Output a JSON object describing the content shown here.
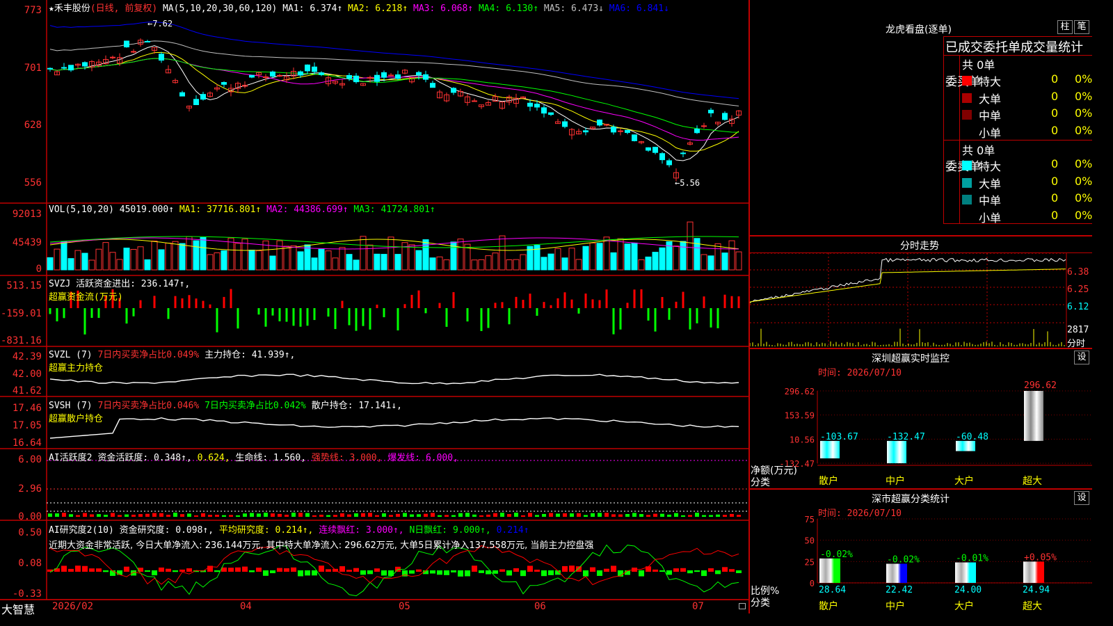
{
  "header": {
    "star": "★",
    "stock_name": "禾丰股份",
    "mode": "(日线, 前复权)",
    "ma_label": "MA(5,10,20,30,60,120)",
    "ma1": "MA1: 6.374↑",
    "ma2": "MA2: 6.218↑",
    "ma3": "MA3: 6.068↑",
    "ma4": "MA4: 6.130↑",
    "ma5": "MA5: 6.473↓",
    "ma6": "MA6: 6.841↓"
  },
  "price_axis": [
    "773",
    "701",
    "628",
    "556"
  ],
  "price_marks": {
    "high": "7.62",
    "low": "5.56"
  },
  "vol_header": {
    "label": "VOL(5,10,20)",
    "value": "45019.000↑",
    "ma1": "MA1: 37716.801↑",
    "ma2": "MA2: 44386.699↑",
    "ma3": "MA3: 41724.801↑"
  },
  "vol_axis": [
    "92013",
    "45439",
    "0"
  ],
  "svzj_header": {
    "l1": "SVZJ  活跃资金进出: 236.147↑,",
    "l2": "超赢资金流(万元)"
  },
  "svzj_axis": [
    "513.15",
    "-159.01",
    "-831.16"
  ],
  "svzl_header": {
    "l1a": "SVZL (7)",
    "l1b": "7日内买卖净占比0.049%",
    "l1c": "主力持仓: 41.939↑,",
    "l2": "超赢主力持仓"
  },
  "svzl_axis": [
    "42.39",
    "42.00",
    "41.62"
  ],
  "svsh_header": {
    "l1a": "SVSH (7)",
    "l1b": "7日内买卖净占比0.046%",
    "l1c": "7日内买卖净占比0.042%",
    "l1d": "散户持仓: 17.141↓,",
    "l2": "超赢散户持仓"
  },
  "svsh_axis": [
    "17.46",
    "17.05",
    "16.64"
  ],
  "ai1_header": {
    "a": "AI活跃度2",
    "b": "资金活跃度: 0.348↑,",
    "c": "0.624,",
    "d": "生命线: 1.560,",
    "e": "强势线: 3.000,",
    "f": "爆发线: 6.000,"
  },
  "ai1_axis": [
    "6.00",
    "2.96",
    "0.00"
  ],
  "ai2_header": {
    "a": "AI研究度2(10)",
    "b": "资金研究度: 0.098↑,",
    "c": "平均研究度: 0.214↑,",
    "d": "连续飘红: 3.000↑,",
    "e": "N日飘红: 9.000↑,",
    "f": "0.214↑",
    "note": "近期大资金非常活跃, 今日大单净流入: 236.144万元, 其中特大单净流入: 296.62万元, 大单5日累计净入137.558万元, 当前主力控盘强"
  },
  "ai2_axis": [
    "0.50",
    "0.08",
    "-0.33"
  ],
  "x_axis": [
    "2026/02",
    "04",
    "05",
    "06",
    "07"
  ],
  "brand": "大智慧",
  "longhu": {
    "title": "龙虎看盘(逐单)",
    "btn_bar": "柱",
    "btn_pen": "笔",
    "tabs": "已成交委托单成交量统计",
    "buy_side": "委买单",
    "sell_side": "委卖单",
    "buy_total": "共 0单",
    "sell_total": "共 0单",
    "buy_rows": [
      {
        "name": "特大",
        "count": "0",
        "pct": "0%",
        "color": "#ff0000"
      },
      {
        "name": "大单",
        "count": "0",
        "pct": "0%",
        "color": "#aa0000"
      },
      {
        "name": "中单",
        "count": "0",
        "pct": "0%",
        "color": "#800000"
      },
      {
        "name": "小单",
        "count": "0",
        "pct": "0%",
        "color": ""
      }
    ],
    "sell_rows": [
      {
        "name": "特大",
        "count": "0",
        "pct": "0%",
        "color": "#00ffff"
      },
      {
        "name": "大单",
        "count": "0",
        "pct": "0%",
        "color": "#00a0a0"
      },
      {
        "name": "中单",
        "count": "0",
        "pct": "0%",
        "color": "#008080"
      },
      {
        "name": "小单",
        "count": "0",
        "pct": "0%",
        "color": ""
      }
    ]
  },
  "intraday": {
    "title": "分时走势",
    "price_axis": [
      "6.38",
      "6.25",
      "6.12"
    ],
    "vol_value": "2817",
    "vol_unit": "分时"
  },
  "sz_monitor": {
    "title": "深圳超赢实时监控",
    "settings": "设",
    "time_label": "时间: 2026/07/10",
    "y_axis": [
      "296.62",
      "153.59",
      "10.56",
      "-132.47"
    ],
    "y_title": "净额(万元)",
    "x_title": "分类",
    "categories": [
      "散户",
      "中户",
      "大户",
      "超大"
    ],
    "values": [
      -103.67,
      -132.47,
      -60.48,
      296.62
    ],
    "value_labels": [
      "-103.67",
      "-132.47",
      "-60.48",
      "296.62"
    ]
  },
  "sz_stats": {
    "title": "深市超赢分类统计",
    "settings": "设",
    "time_label": "时间: 2026/07/10",
    "y_axis": [
      "75",
      "50",
      "25",
      "0"
    ],
    "y_title": "比例%",
    "x_title": "分类",
    "categories": [
      "散户",
      "中户",
      "大户",
      "超大"
    ],
    "ratios": [
      28.64,
      22.42,
      24.0,
      24.94
    ],
    "ratio_labels": [
      "28.64",
      "22.42",
      "24.00",
      "24.94"
    ],
    "changes": [
      "-0.02%",
      "-0.02%",
      "-0.01%",
      "+0.05%"
    ],
    "bar_colors": [
      "#00ff00",
      "#0000ff",
      "#00ffff",
      "#ff0000"
    ]
  },
  "colors": {
    "up": "#ff3232",
    "down": "#00ffff",
    "grid": "#c00000",
    "ma1": "#ffffff",
    "ma2": "#ffff00",
    "ma3": "#ff00ff",
    "ma4": "#00ff00",
    "ma5": "#c0c0c0",
    "ma6": "#0000ff"
  }
}
